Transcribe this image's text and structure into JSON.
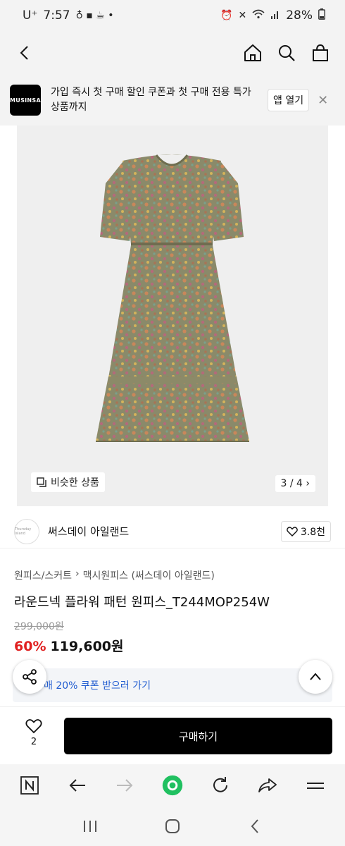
{
  "status_bar": {
    "carrier": "U⁺",
    "time": "7:57",
    "battery": "28%"
  },
  "promo": {
    "logo_text": "MUSINSA",
    "message": "가입 즉시 첫 구매 할인 쿠폰과 첫 구매 전용 특가 상품까지",
    "open_app_label": "앱 열기"
  },
  "gallery": {
    "similar_label": "비슷한 상품",
    "page_indicator": "3 / 4"
  },
  "brand": {
    "name": "써스데이 아일랜드",
    "logo_text": "Thursday Island",
    "like_count": "3.8천"
  },
  "breadcrumb": {
    "category": "원피스/스커트",
    "separator": "›",
    "subcategory": "맥시원피스 (써스데이 아일랜드)"
  },
  "product": {
    "title": "라운드넥 플라워 패턴 원피스_T244MOP254W",
    "original_price": "299,000원",
    "discount_rate": "60%",
    "sale_price": "119,600원"
  },
  "coupon": {
    "label": "매 20% 쿠폰 받으러 가기"
  },
  "purchase": {
    "wish_count": "2",
    "buy_label": "구매하기"
  },
  "colors": {
    "discount": "#e02020",
    "coupon_text": "#1f5bd0",
    "buy_button": "#000000",
    "browser_home": "#20c060"
  }
}
